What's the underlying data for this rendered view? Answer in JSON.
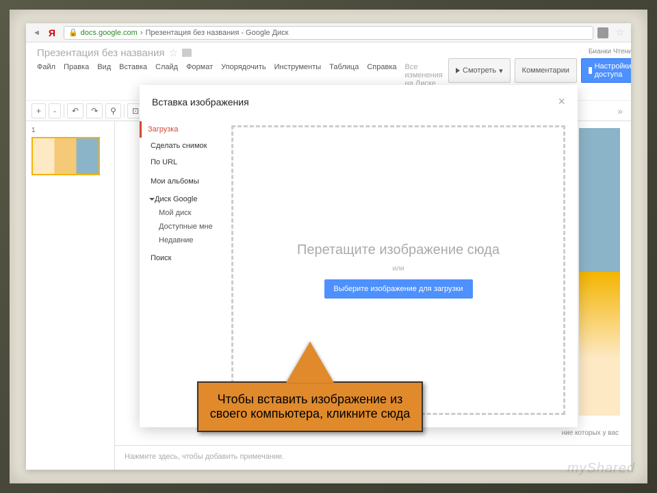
{
  "browser": {
    "yandex_label": "Я",
    "host": "docs.google.com",
    "separator": "›",
    "page_title": "Презентация без названия - Google Диск"
  },
  "header": {
    "doc_title": "Презентация без названия",
    "user": "Бианки Чтения ▾",
    "view_btn": "Смотреть",
    "comments_btn": "Комментарии",
    "share_btn": "Настройки доступа"
  },
  "menus": {
    "file": "Файл",
    "edit": "Правка",
    "view": "Вид",
    "insert": "Вставка",
    "slide": "Слайд",
    "format": "Формат",
    "arrange": "Упорядочить",
    "tools": "Инструменты",
    "table": "Таблица",
    "help": "Справка",
    "saved": "Все изменения на Диске сохранены"
  },
  "toolbar": {
    "plus": "+",
    "minus": "-",
    "undo": "↶",
    "redo": "↷",
    "paint": "⚲"
  },
  "slide_panel": {
    "num": "1"
  },
  "modal": {
    "title": "Вставка изображения",
    "close": "×",
    "side": {
      "upload": "Загрузка",
      "snapshot": "Сделать снимок",
      "by_url": "По URL",
      "albums": "Мои альбомы",
      "drive": "Диск Google",
      "my_drive": "Мой диск",
      "shared": "Доступные мне",
      "recent": "Недавние",
      "search": "Поиск"
    },
    "drop_text": "Перетащите изображение сюда",
    "or": "или",
    "upload_btn": "Выберите изображение для загрузки"
  },
  "callout": {
    "text": "Чтобы вставить изображение из своего компьютера, кликните сюда"
  },
  "notes": {
    "placeholder": "Нажмите здесь, чтобы добавить примечание."
  },
  "hint_below": "ние которых у вас",
  "watermark": "myShared"
}
